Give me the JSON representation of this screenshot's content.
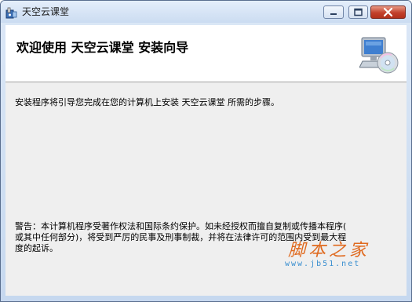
{
  "window": {
    "title": "天空云课堂"
  },
  "controls": {
    "minimize_icon": "minimize-icon",
    "maximize_icon": "maximize-icon",
    "close_icon": "close-icon"
  },
  "header": {
    "title": "欢迎使用  天空云课堂  安装向导",
    "graphic_icon": "computer-cd-icon"
  },
  "content": {
    "intro": "安装程序将引导您完成在您的计算机上安装 天空云课堂 所需的步骤。",
    "warning": "警告：本计算机程序受著作权法和国际条约保护。如未经授权而擅自复制或传播本程序(\n或其中任何部分)，将受到严厉的民事及刑事制裁，并将在法律许可的范围内受到最大程\n度的起诉。"
  },
  "watermark": {
    "text": "脚本之家",
    "url": "www.jb51.net"
  },
  "colors": {
    "titlebar": "#cbdcf1",
    "header_bg": "#ffffff",
    "content_bg": "#efefef",
    "close_button": "#c2412c",
    "watermark_text": "#e06a1f",
    "watermark_url": "#3a8fd0"
  }
}
